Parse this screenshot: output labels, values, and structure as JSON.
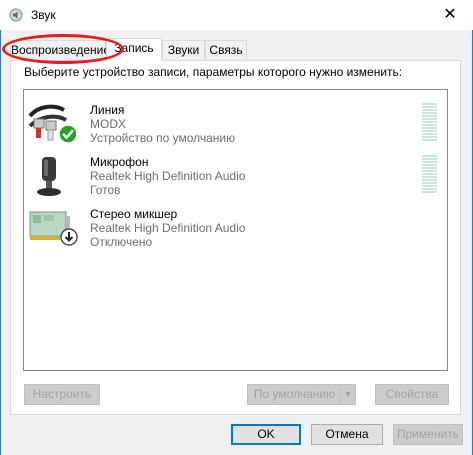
{
  "window": {
    "title": "Звук",
    "close_glyph": "✕",
    "accent": "#2b78c8"
  },
  "tabs": [
    {
      "label": "Воспроизведение"
    },
    {
      "label": "Запись"
    },
    {
      "label": "Звуки"
    },
    {
      "label": "Связь"
    }
  ],
  "active_tab": "Запись",
  "instruction": "Выберите устройство записи, параметры которого нужно изменить:",
  "devices": [
    {
      "name": "Линия",
      "line1": "MODX",
      "line2": "Устройство по умолчанию",
      "icon": "line-in-icon",
      "status_icon": "default-check-icon",
      "status_color": "#2ca02c",
      "level": 0
    },
    {
      "name": "Микрофон",
      "line1": "Realtek High Definition Audio",
      "line2": "Готов",
      "icon": "microphone-icon",
      "level": 0
    },
    {
      "name": "Стерео микшер",
      "line1": "Realtek High Definition Audio",
      "line2": "Отключено",
      "icon": "stereo-mixer-icon",
      "status_icon": "disabled-arrow-icon",
      "level": null
    }
  ],
  "buttons": {
    "configure": "Настроить",
    "set_default": "По умолчанию",
    "properties": "Свойства",
    "ok": "OK",
    "cancel": "Отмена",
    "apply": "Применить"
  },
  "annotation_color": "#e02020"
}
